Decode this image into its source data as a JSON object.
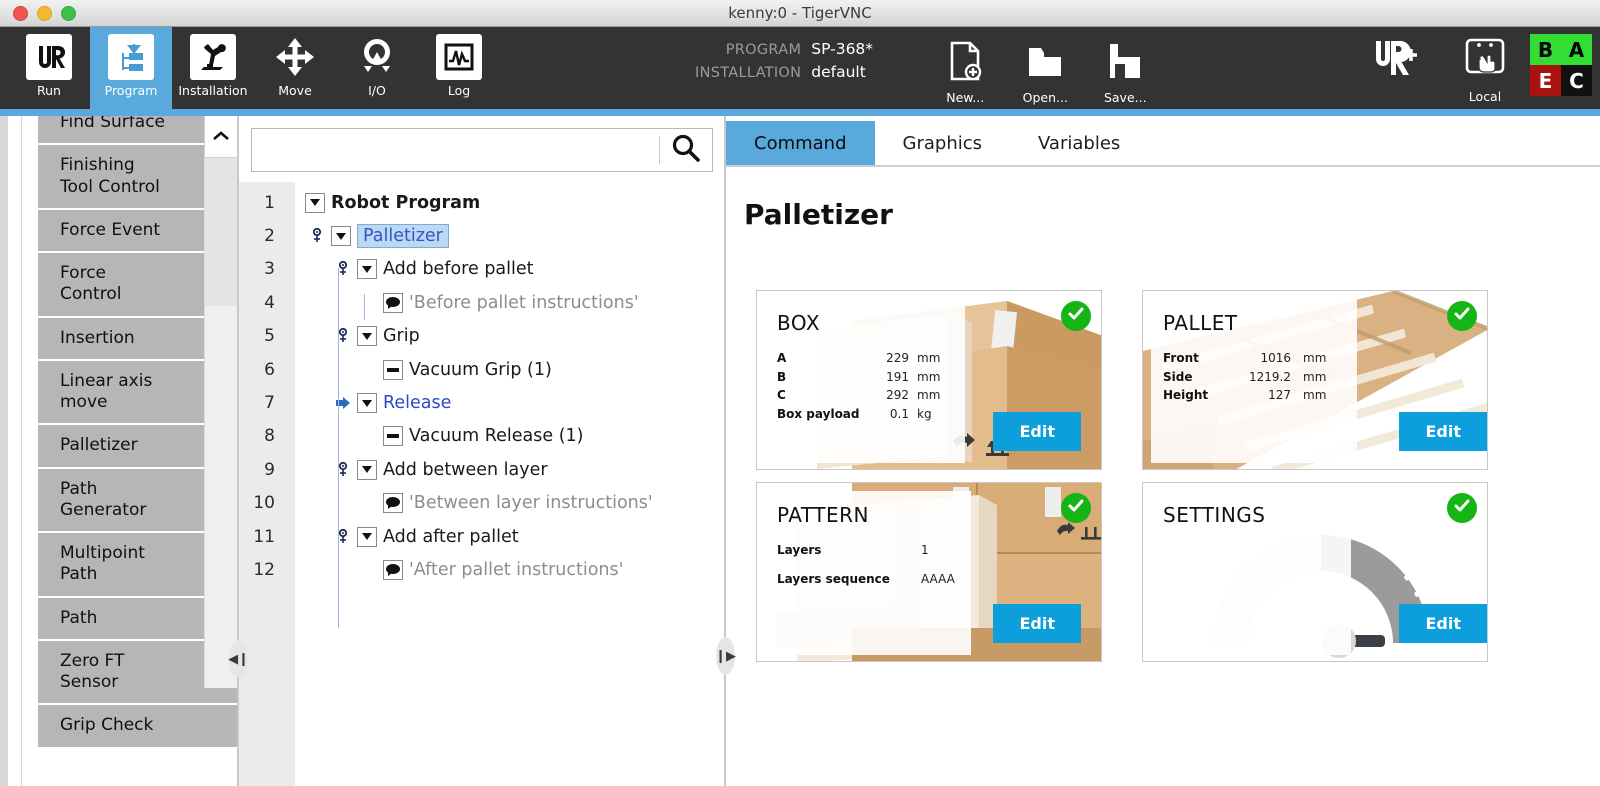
{
  "window": {
    "title": "kenny:0 - TigerVNC",
    "buttons": [
      "close",
      "minimize",
      "maximize"
    ]
  },
  "toolbar": {
    "items": [
      {
        "label": "Run",
        "icon": "ur-logo-icon",
        "active": false
      },
      {
        "label": "Program",
        "icon": "program-tree-icon",
        "active": true
      },
      {
        "label": "Installation",
        "icon": "robot-arm-icon",
        "active": false
      },
      {
        "label": "Move",
        "icon": "move-arrows-icon",
        "active": false
      },
      {
        "label": "I/O",
        "icon": "io-icon",
        "active": false
      },
      {
        "label": "Log",
        "icon": "log-waveform-icon",
        "active": false
      }
    ],
    "program_key": "PROGRAM",
    "program_value": "SP-368*",
    "installation_key": "INSTALLATION",
    "installation_value": "default",
    "file_buttons": [
      {
        "label": "New...",
        "icon": "new-file-icon"
      },
      {
        "label": "Open...",
        "icon": "open-folder-icon"
      },
      {
        "label": "Save...",
        "icon": "save-floppy-icon"
      }
    ],
    "urplus_icon": "ur-plus-icon",
    "local_label": "Local",
    "local_icon": "teach-pendant-icon",
    "status_squares": [
      {
        "text": "B",
        "bg": "#33dd33",
        "fg": "#000000"
      },
      {
        "text": "A",
        "bg": "#33dd33",
        "fg": "#000000"
      },
      {
        "text": "E",
        "bg": "#aa1111",
        "fg": "#ffffff"
      },
      {
        "text": "C",
        "bg": "#111111",
        "fg": "#ffffff"
      }
    ]
  },
  "node_list": {
    "scroll_up_icon": "chevron-up-icon",
    "items": [
      "Find Surface",
      "Finishing\nTool Control",
      "Force Event",
      "Force\nControl",
      "Insertion",
      "Linear axis\nmove",
      "Palletizer",
      "Path\nGenerator",
      "Multipoint\nPath",
      "Path",
      "Zero FT\nSensor",
      "Grip Check"
    ]
  },
  "tree_panel": {
    "search": {
      "value": "",
      "placeholder": "",
      "icon": "search-icon"
    },
    "rows": [
      {
        "num": "1",
        "indent": 0,
        "toggle": "triangle-down",
        "label": "Robot Program",
        "style": "bold",
        "marker": "none"
      },
      {
        "num": "2",
        "indent": 1,
        "toggle": "triangle-down",
        "label": "Palletizer",
        "style": "selected",
        "marker": "suppress"
      },
      {
        "num": "3",
        "indent": 2,
        "toggle": "triangle-down",
        "label": "Add before pallet",
        "style": "normal",
        "marker": "suppress"
      },
      {
        "num": "4",
        "indent": 3,
        "toggle": "comment",
        "label": "'Before pallet instructions'",
        "style": "grey",
        "marker": "none"
      },
      {
        "num": "5",
        "indent": 2,
        "toggle": "triangle-down",
        "label": "Grip",
        "style": "normal",
        "marker": "suppress"
      },
      {
        "num": "6",
        "indent": 3,
        "toggle": "dash",
        "label": "Vacuum Grip  (1)",
        "style": "normal",
        "marker": "none"
      },
      {
        "num": "7",
        "indent": 2,
        "toggle": "triangle-down",
        "label": "Release",
        "style": "blue",
        "marker": "arrow"
      },
      {
        "num": "8",
        "indent": 3,
        "toggle": "dash",
        "label": "Vacuum Release  (1)",
        "style": "normal",
        "marker": "none"
      },
      {
        "num": "9",
        "indent": 2,
        "toggle": "triangle-down",
        "label": "Add between layer",
        "style": "normal",
        "marker": "suppress"
      },
      {
        "num": "10",
        "indent": 3,
        "toggle": "comment",
        "label": "'Between layer instructions'",
        "style": "grey",
        "marker": "none"
      },
      {
        "num": "11",
        "indent": 2,
        "toggle": "triangle-down",
        "label": "Add after pallet",
        "style": "normal",
        "marker": "suppress"
      },
      {
        "num": "12",
        "indent": 3,
        "toggle": "comment",
        "label": "'After pallet instructions'",
        "style": "grey",
        "marker": "none"
      }
    ]
  },
  "right_panel": {
    "tabs": [
      {
        "label": "Command",
        "active": true
      },
      {
        "label": "Graphics",
        "active": false
      },
      {
        "label": "Variables",
        "active": false
      }
    ],
    "title": "Palletizer",
    "cards": [
      {
        "id": "box",
        "title": "BOX",
        "art": "cardboard-box-art",
        "status": "valid",
        "check_icon": "check-circle-icon",
        "edit_label": "Edit",
        "specs": [
          {
            "key": "A",
            "value": "229",
            "unit": "mm"
          },
          {
            "key": "B",
            "value": "191",
            "unit": "mm"
          },
          {
            "key": "C",
            "value": "292",
            "unit": "mm"
          },
          {
            "key": "Box payload",
            "value": "0.1",
            "unit": "kg"
          }
        ]
      },
      {
        "id": "pallet",
        "title": "PALLET",
        "art": "wooden-pallet-art",
        "status": "valid",
        "check_icon": "check-circle-icon",
        "edit_label": "Edit",
        "specs": [
          {
            "key": "Front",
            "value": "1016",
            "unit": "mm"
          },
          {
            "key": "Side",
            "value": "1219.2",
            "unit": "mm"
          },
          {
            "key": "Height",
            "value": "127",
            "unit": "mm"
          }
        ]
      },
      {
        "id": "pattern",
        "title": "PATTERN",
        "art": "stacked-boxes-art",
        "status": "valid",
        "check_icon": "check-circle-icon",
        "edit_label": "Edit",
        "specs": [
          {
            "key": "Layers",
            "value": "1",
            "unit": ""
          },
          {
            "key": "Layers sequence",
            "value": "AAAA",
            "unit": ""
          }
        ]
      },
      {
        "id": "settings",
        "title": "SETTINGS",
        "art": "speed-gauge-art",
        "status": "valid",
        "check_icon": "check-circle-icon",
        "edit_label": "Edit",
        "specs": []
      }
    ]
  },
  "splitters": {
    "left_glyph": "◀❙",
    "right_glyph": "❙▶"
  },
  "colors": {
    "accent_blue": "#5aa9dd",
    "edit_blue": "#0d9fdc",
    "toolbar_dark": "#333333",
    "valid_green": "#16b516",
    "node_grey": "#b6b6b6"
  }
}
